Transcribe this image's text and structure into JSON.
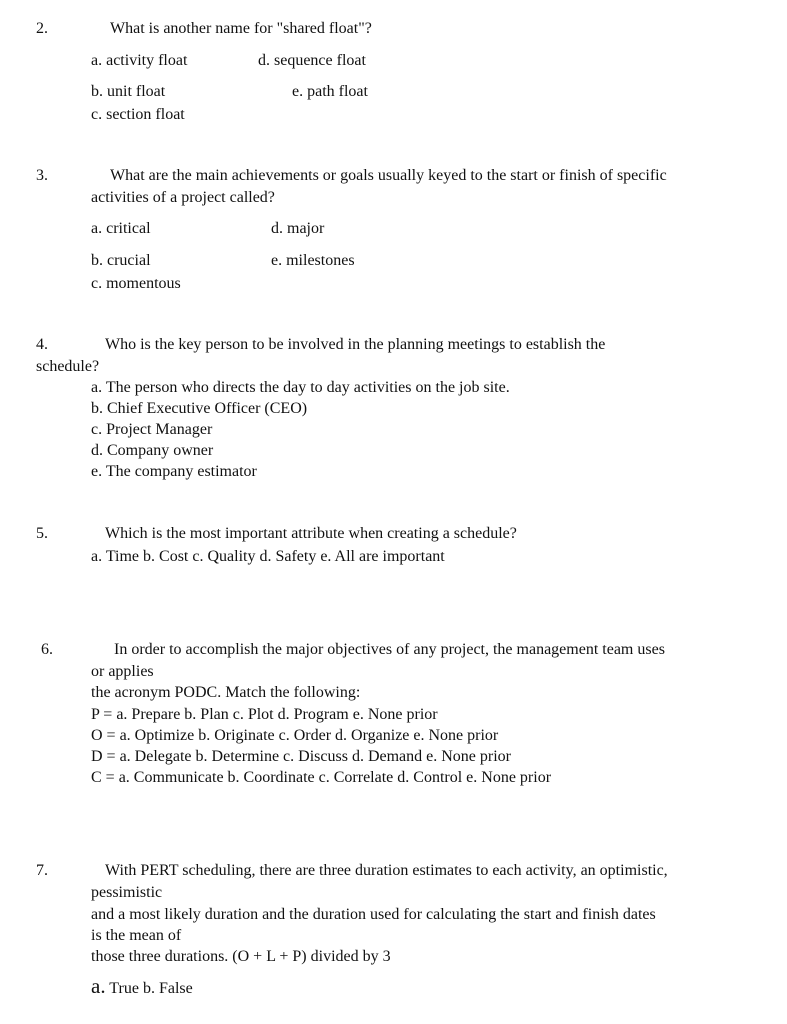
{
  "questions": [
    {
      "number": "2.",
      "prompt": "What is another name for \"shared float\"?",
      "options": {
        "a": "a. activity float",
        "b": "b. unit float",
        "c": "c. section float",
        "d": "d. sequence float",
        "e": "e. path float"
      }
    },
    {
      "number": "3.",
      "prompt_line1": "What are the main achievements or goals usually keyed to the start or finish of specific",
      "prompt_line2": "activities of a project called?",
      "options": {
        "a": "a. critical",
        "b": "b. crucial",
        "c": "c. momentous",
        "d": "d. major",
        "e": "e. milestones"
      }
    },
    {
      "number": "4.",
      "prompt_line1": "Who is the key person to be involved in the planning meetings to establish the",
      "prompt_line2": "schedule?",
      "options": [
        "a. The person who directs the day to day activities on the job site.",
        "b. Chief Executive Officer (CEO)",
        "c. Project Manager",
        "d. Company owner",
        "e. The company estimator"
      ]
    },
    {
      "number": "5.",
      "prompt": "Which is the most important attribute when creating a schedule?",
      "options_line": "a. Time b. Cost c. Quality d. Safety e. All are important"
    },
    {
      "number": "6.",
      "prompt_line1": "In order to accomplish the major objectives of any project, the management team uses",
      "prompt_line2": "or applies",
      "prompt_line3": "the acronym PODC. Match the following:",
      "matches": [
        "P = a. Prepare b. Plan c. Plot d. Program e. None prior",
        "O = a. Optimize b. Originate c. Order d. Organize e. None prior",
        "D = a. Delegate b. Determine c. Discuss d. Demand e. None prior",
        "C = a. Communicate b. Coordinate c. Correlate d. Control e. None prior"
      ]
    },
    {
      "number": "7.",
      "prompt_lines": [
        "With PERT scheduling, there are three duration estimates to each activity, an optimistic,",
        "pessimistic",
        "and a most likely duration and the duration used for calculating the start and finish dates",
        "is the mean of",
        "those three durations. (O + L + P) divided by 3"
      ],
      "option_a_marker": "a.",
      "options_rest": "True b. False"
    }
  ]
}
